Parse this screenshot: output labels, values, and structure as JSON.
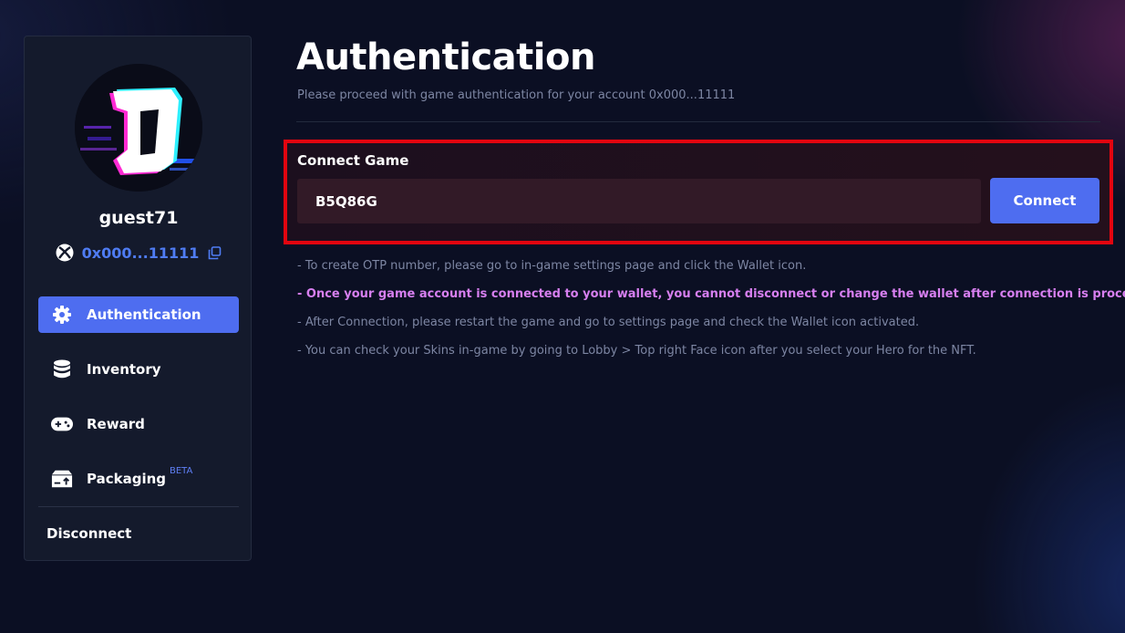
{
  "profile": {
    "username": "guest71",
    "wallet_address": "0x000...11111"
  },
  "sidebar": {
    "items": [
      {
        "label": "Authentication",
        "icon": "gear-icon",
        "active": true
      },
      {
        "label": "Inventory",
        "icon": "database-icon",
        "active": false
      },
      {
        "label": "Reward",
        "icon": "gamepad-icon",
        "active": false
      },
      {
        "label": "Packaging",
        "icon": "package-icon",
        "badge": "BETA",
        "active": false
      }
    ],
    "disconnect_label": "Disconnect"
  },
  "page": {
    "title": "Authentication",
    "subtitle": "Please proceed with game authentication for your account 0x000...11111"
  },
  "connect": {
    "label": "Connect Game",
    "input_value": "B5Q86G",
    "button_label": "Connect"
  },
  "notes": [
    "- To create OTP number, please go to in-game settings page and click the Wallet icon.",
    "- Once your game account is connected to your wallet, you cannot disconnect or change the wallet after connection is processed.",
    "- After Connection, please restart the game and go to settings page and check the Wallet icon activated.",
    "- You can check your Skins in-game by going to Lobby > Top right Face icon after you select your Hero for the NFT."
  ],
  "colors": {
    "background": "#0b0f23",
    "accent": "#4e6df0",
    "highlight_border": "#e2050f",
    "warning_text": "#d77ff0",
    "muted_text": "#7d86a3"
  }
}
